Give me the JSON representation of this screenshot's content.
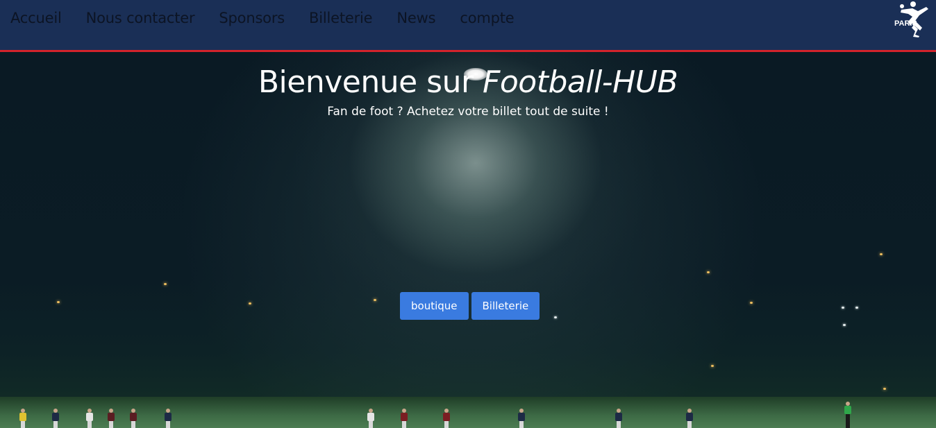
{
  "nav": {
    "links": [
      "Accueil",
      "Nous contacter",
      "Sponsors",
      "Billeterie",
      "News",
      "compte"
    ],
    "logo_text": "PARIS",
    "background_color": "#1a2f56",
    "border_color": "#d3232b"
  },
  "hero": {
    "title_prefix": "Bienvenue sur ",
    "title_brand": "Football-HUB",
    "subtitle": "Fan de foot ? Achetez votre billet tout de suite !",
    "buttons": {
      "shop_label": "boutique",
      "tickets_label": "Billeterie"
    },
    "button_color": "#3a7be0"
  },
  "icons": {
    "logo": "bicycle-kick-footballer-logo-icon"
  }
}
